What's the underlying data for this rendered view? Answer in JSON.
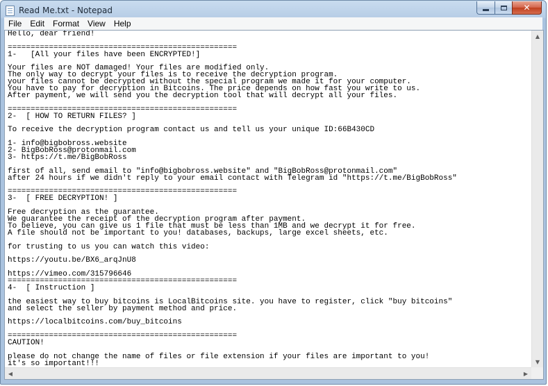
{
  "window": {
    "title": "Read Me.txt - Notepad",
    "minimize_label": "",
    "maximize_label": "",
    "close_label": "✕"
  },
  "menu": [
    {
      "label": "File"
    },
    {
      "label": "Edit"
    },
    {
      "label": "Format"
    },
    {
      "label": "View"
    },
    {
      "label": "Help"
    }
  ],
  "document": {
    "lines": [
      "Hello, dear friend!",
      "",
      "==================================================",
      "1-   [All your files have been ENCRYPTED!]",
      "",
      "Your files are NOT damaged! Your files are modified only.",
      "The only way to decrypt your files is to receive the decryption program.",
      "your files cannot be decrypted without the special program we made it for your computer.",
      "You have to pay for decryption in Bitcoins. The price depends on how fast you write to us.",
      "After payment, we will send you the decryption tool that will decrypt all your files.",
      "",
      "==================================================",
      "2-  [ HOW TO RETURN FILES? ]",
      "",
      "To receive the decryption program contact us and tell us your unique ID:66B430CD",
      "",
      "1- info@bigbobross.website",
      "2- BigBobRoss@protonmail.com",
      "3- https://t.me/BigBobRoss",
      "",
      "first of all, send email to \"info@bigbobross.website\" and \"BigBobRoss@protonmail.com\"",
      "after 24 hours if we didn't reply to your email contact with Telegram id \"https://t.me/BigBobRoss\"",
      "",
      "==================================================",
      "3-  [ FREE DECRYPTION! ]",
      "",
      "Free decryption as the guarantee.",
      "We guarantee the receipt of the decryption program after payment.",
      "To believe, you can give us 1 file that must be less than 1MB and we decrypt it for free.",
      "A file should not be important to you! databases, backups, large excel sheets, etc.",
      "",
      "for trusting to us you can watch this video:",
      "",
      "https://youtu.be/BX6_arqJnU8",
      "",
      "https://vimeo.com/315796646",
      "==================================================",
      "4-  [ Instruction ]",
      "",
      "the easiest way to buy bitcoins is LocalBitcoins site. you have to register, click \"buy bitcoins\"",
      "and select the seller by payment method and price.",
      "",
      "https://localbitcoins.com/buy_bitcoins",
      "",
      "==================================================",
      "CAUTION!",
      "",
      "please do not change the name of files or file extension if your files are important to you!",
      "it's so important!!!"
    ]
  },
  "icons": {
    "app": "notepad-icon",
    "scroll_up": "chevron-up-icon",
    "scroll_down": "chevron-down-icon",
    "scroll_left": "chevron-left-icon",
    "scroll_right": "chevron-right-icon"
  },
  "colors": {
    "close_button": "#c0401f",
    "title_bar": "#b7cde6",
    "editor_background": "#ffffff"
  }
}
